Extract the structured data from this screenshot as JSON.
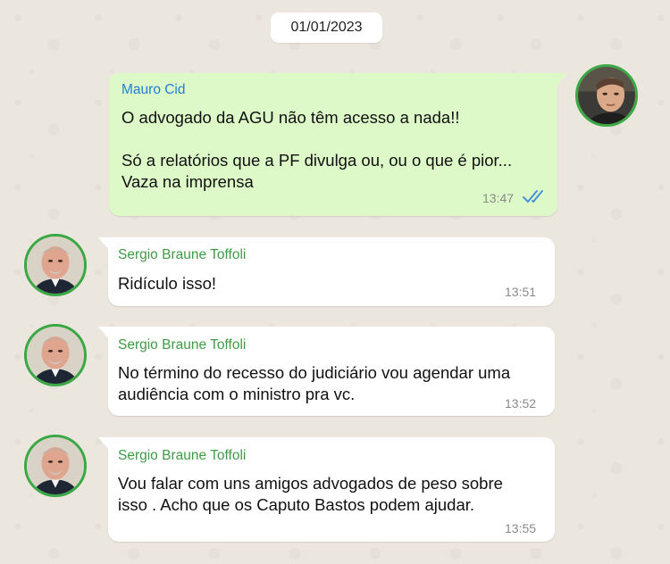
{
  "chat": {
    "date": "01/01/2023",
    "messages": [
      {
        "direction": "outgoing",
        "sender": "Mauro Cid",
        "text": "O advogado da AGU não têm acesso a nada!!\n\nSó a relatórios que a PF divulga ou, ou o que é pior...\nVaza na imprensa",
        "time": "13:47",
        "status": "read"
      },
      {
        "direction": "incoming",
        "sender": "Sergio Braune Toffoli",
        "text": "Ridículo isso!",
        "time": "13:51"
      },
      {
        "direction": "incoming",
        "sender": "Sergio Braune Toffoli",
        "text": "No término do recesso do judiciário vou agendar uma\naudiência com o ministro pra vc.",
        "time": "13:52"
      },
      {
        "direction": "incoming",
        "sender": "Sergio Braune Toffoli",
        "text": "Vou falar com uns amigos advogados de peso sobre\nisso . Acho que os Caputo Bastos podem ajudar.",
        "time": "13:55"
      }
    ]
  },
  "colors": {
    "outgoing_bubble": "#ddf9c8",
    "incoming_bubble": "#ffffff",
    "outgoing_sender": "#1f7fd4",
    "incoming_sender": "#3f9b45",
    "avatar_ring": "#3aa845",
    "read_ticks": "#4a90d9"
  },
  "icons": {
    "read_status": "double-check-icon"
  }
}
